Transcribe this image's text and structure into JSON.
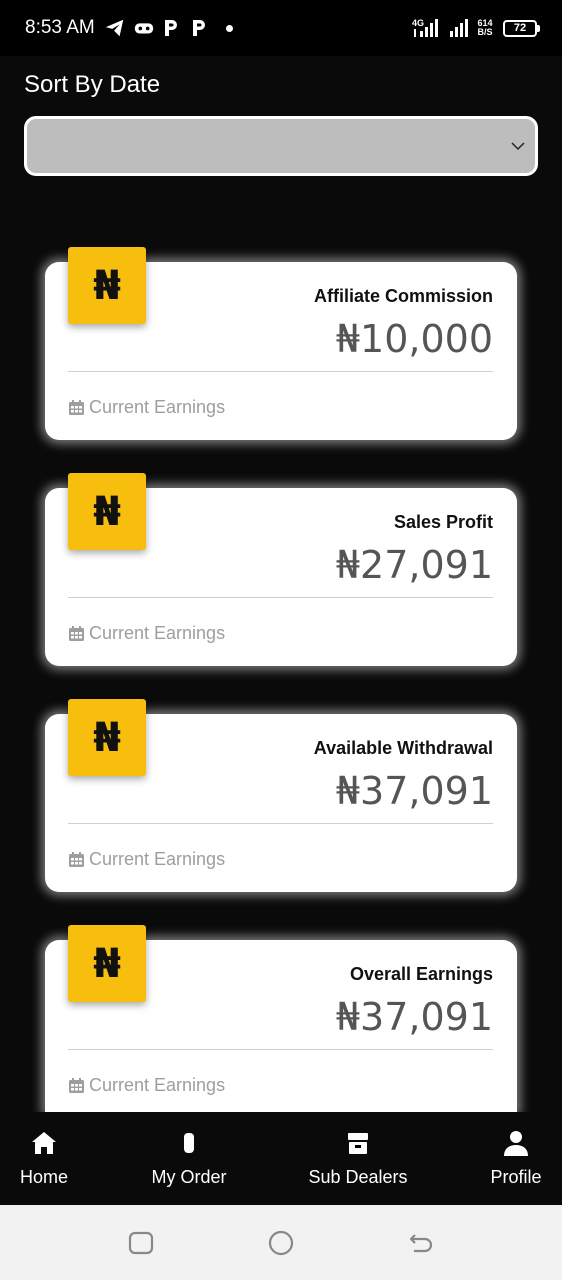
{
  "status_bar": {
    "time": "8:53 AM",
    "icons": [
      "telegram-icon",
      "game-controller-icon",
      "p-icon",
      "p-icon",
      "dot-icon"
    ],
    "network": "4G",
    "speed_value": "614",
    "speed_unit": "B/S",
    "battery": "72"
  },
  "sort": {
    "label": "Sort By Date",
    "selected": ""
  },
  "currency_symbol": "₦",
  "cards": [
    {
      "title": "Affiliate Commission",
      "value": "₦10,000",
      "footer": "Current Earnings"
    },
    {
      "title": "Sales Profit",
      "value": "₦27,091",
      "footer": "Current Earnings"
    },
    {
      "title": "Available Withdrawal",
      "value": "₦37,091",
      "footer": "Current Earnings"
    },
    {
      "title": "Overall Earnings",
      "value": "₦37,091",
      "footer": "Current Earnings"
    }
  ],
  "nav": [
    {
      "label": "Home",
      "icon": "home-icon"
    },
    {
      "label": "My Order",
      "icon": "order-icon"
    },
    {
      "label": "Sub Dealers",
      "icon": "store-icon"
    },
    {
      "label": "Profile",
      "icon": "person-icon"
    }
  ],
  "colors": {
    "accent": "#f7be0d",
    "background": "#0a0a0a",
    "card": "#ffffff"
  }
}
